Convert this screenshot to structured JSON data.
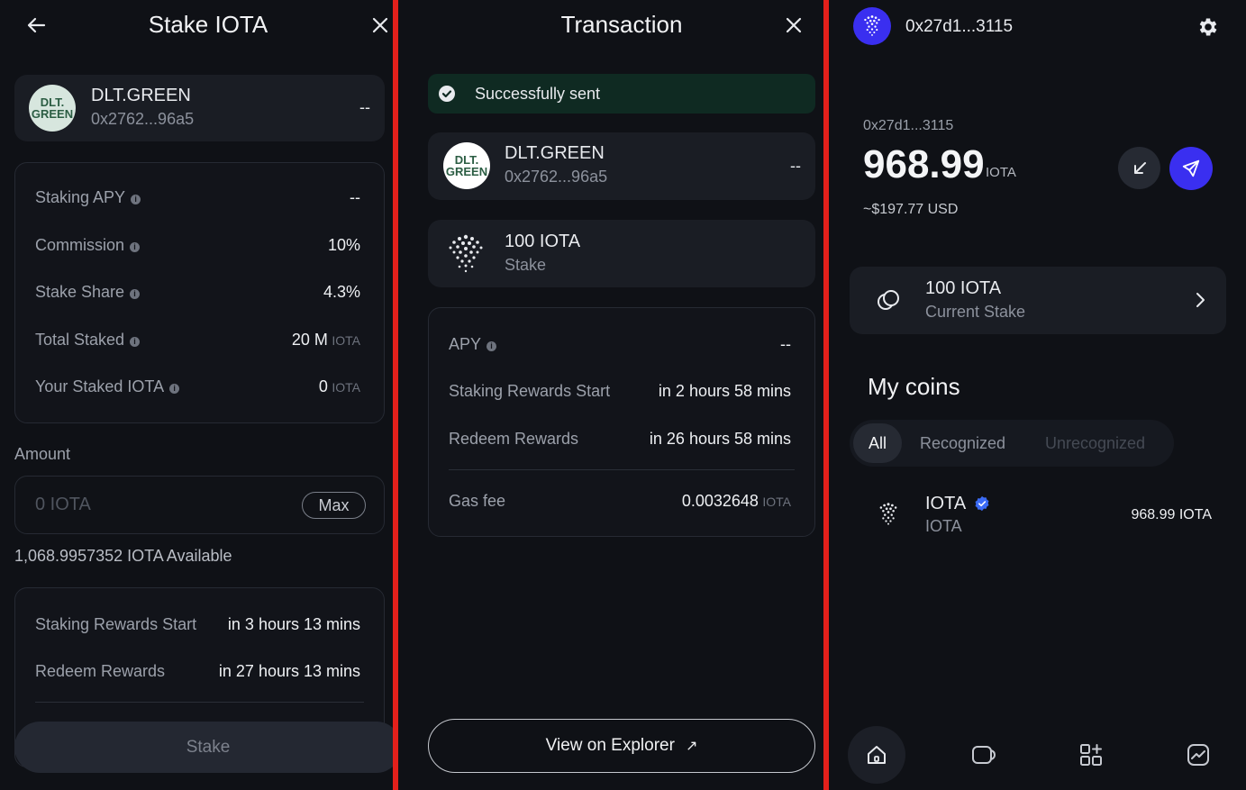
{
  "stake_panel": {
    "title": "Stake IOTA",
    "validator": {
      "logo_line1": "DLT.",
      "logo_line2": "GREEN",
      "name": "DLT.GREEN",
      "address": "0x2762...96a5",
      "value": "--"
    },
    "stats": [
      {
        "label": "Staking APY",
        "value": "--",
        "unit": ""
      },
      {
        "label": "Commission",
        "value": "10%",
        "unit": ""
      },
      {
        "label": "Stake Share",
        "value": "4.3%",
        "unit": ""
      },
      {
        "label": "Total Staked",
        "value": "20 M",
        "unit": "IOTA"
      },
      {
        "label": "Your Staked IOTA",
        "value": "0",
        "unit": "IOTA"
      }
    ],
    "amount_label": "Amount",
    "amount_placeholder": "0 IOTA",
    "max_label": "Max",
    "available": "1,068.9957352 IOTA Available",
    "rewards": [
      {
        "label": "Staking Rewards Start",
        "value": "in 3 hours 13 mins"
      },
      {
        "label": "Redeem Rewards",
        "value": "in 27 hours 13 mins"
      }
    ],
    "stake_button": "Stake"
  },
  "transaction_panel": {
    "title": "Transaction",
    "status": "Successfully sent",
    "validator": {
      "logo_line1": "DLT.",
      "logo_line2": "GREEN",
      "name": "DLT.GREEN",
      "address": "0x2762...96a5",
      "value": "--"
    },
    "amount": {
      "title": "100 IOTA",
      "subtitle": "Stake"
    },
    "details": [
      {
        "label": "APY",
        "value": "--",
        "unit": "",
        "info": true
      },
      {
        "label": "Staking Rewards Start",
        "value": "in 2 hours 58 mins",
        "unit": "",
        "info": false
      },
      {
        "label": "Redeem Rewards",
        "value": "in 26 hours 58 mins",
        "unit": "",
        "info": false
      }
    ],
    "gas": {
      "label": "Gas fee",
      "value": "0.0032648",
      "unit": "IOTA"
    },
    "explorer_button": "View on Explorer",
    "explorer_arrow": "↗"
  },
  "wallet_panel": {
    "account": "0x27d1...3115",
    "balance_account": "0x27d1...3115",
    "balance": "968.99",
    "balance_unit": "IOTA",
    "balance_usd": "~$197.77 USD",
    "stake": {
      "title": "100 IOTA",
      "subtitle": "Current Stake"
    },
    "my_coins": "My coins",
    "filters": [
      "All",
      "Recognized",
      "Unrecognized"
    ],
    "coin": {
      "symbol": "IOTA",
      "name": "IOTA",
      "amount": "968.99 IOTA"
    }
  },
  "colors": {
    "accent": "#3a2ff0",
    "divider": "#e3201b",
    "success": "#0f2a22",
    "verified": "#3b6bf5"
  },
  "icons": [
    "back-arrow-icon",
    "close-icon",
    "check-circle-icon",
    "iota-logo-icon",
    "external-link-icon",
    "settings-gear-icon",
    "receive-icon",
    "send-icon",
    "stake-coins-icon",
    "chevron-right-icon",
    "verified-badge-icon",
    "home-icon",
    "assets-icon",
    "apps-icon",
    "activity-icon"
  ]
}
